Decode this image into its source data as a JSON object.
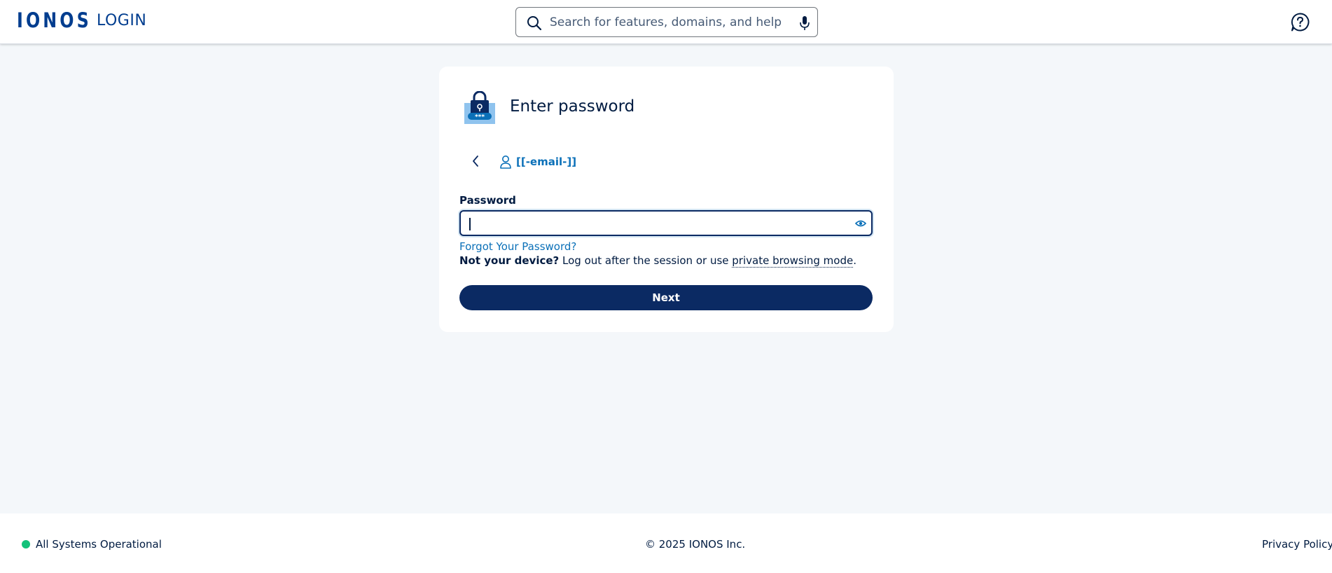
{
  "header": {
    "logo_text": "IONOS",
    "title": "LOGIN",
    "search_placeholder": "Search for features, domains, and help",
    "icons": [
      "search-icon",
      "microphone-icon",
      "help-chat-icon"
    ]
  },
  "card": {
    "title": "Enter password",
    "illustration": "lock-password-icon",
    "account_email": "[[-email-]]",
    "password_label": "Password",
    "password_value": "",
    "forgot_password": "Forgot Your Password?",
    "device_note_bold": "Not your device?",
    "device_note_text": " Log out after the session or use ",
    "device_note_link": "private browsing mode",
    "device_note_end": ".",
    "next_label": "Next",
    "icons": [
      "chevron-left-icon",
      "user-icon",
      "eye-icon"
    ]
  },
  "footer": {
    "status": "All Systems Operational",
    "status_color": "#13c27a",
    "copyright": "© 2025 IONOS Inc.",
    "privacy": "Privacy Policy -"
  },
  "colors": {
    "brand_blue": "#003d8f",
    "primary_button": "#0b2a63",
    "link_blue": "#0b70b8",
    "background": "#f4f7fa"
  }
}
